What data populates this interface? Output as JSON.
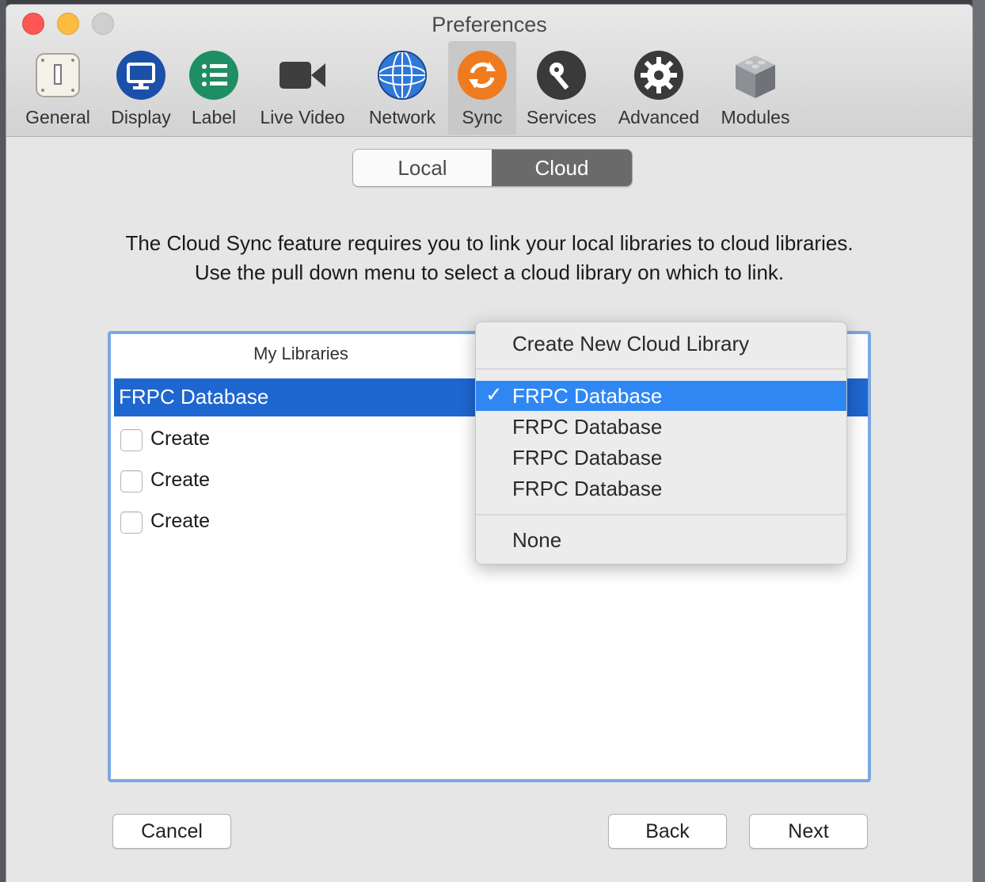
{
  "window": {
    "title": "Preferences"
  },
  "toolbar": {
    "items": [
      {
        "label": "General",
        "icon": "general-icon"
      },
      {
        "label": "Display",
        "icon": "display-icon"
      },
      {
        "label": "Label",
        "icon": "label-list-icon"
      },
      {
        "label": "Live Video",
        "icon": "video-camera-icon"
      },
      {
        "label": "Network",
        "icon": "globe-icon"
      },
      {
        "label": "Sync",
        "icon": "sync-icon",
        "active": true
      },
      {
        "label": "Services",
        "icon": "key-icon"
      },
      {
        "label": "Advanced",
        "icon": "gear-icon"
      },
      {
        "label": "Modules",
        "icon": "module-cube-icon"
      }
    ]
  },
  "segment": {
    "local": "Local",
    "cloud": "Cloud",
    "selected": "Cloud"
  },
  "description": "The Cloud Sync feature requires you to link your local libraries to cloud libraries. Use the pull down menu to select a cloud library on which to link.",
  "libraries": {
    "column_header": "My Libraries",
    "selected_row": "FRPC Database",
    "rows": [
      {
        "label": "Create",
        "checked": false
      },
      {
        "label": "Create",
        "checked": false
      },
      {
        "label": "Create",
        "checked": false
      }
    ]
  },
  "menu": {
    "create_new": "Create New Cloud Library",
    "checkmark": "✓",
    "options": [
      "FRPC Database",
      "FRPC Database",
      "FRPC Database",
      "FRPC Database"
    ],
    "selected_index": 0,
    "none": "None"
  },
  "buttons": {
    "cancel": "Cancel",
    "back": "Back",
    "next": "Next"
  },
  "colors": {
    "selection": "#1e66d0",
    "menu_highlight": "#2f87f4",
    "focus_ring": "#7ba8e3",
    "sync_orange": "#f07a1e"
  }
}
